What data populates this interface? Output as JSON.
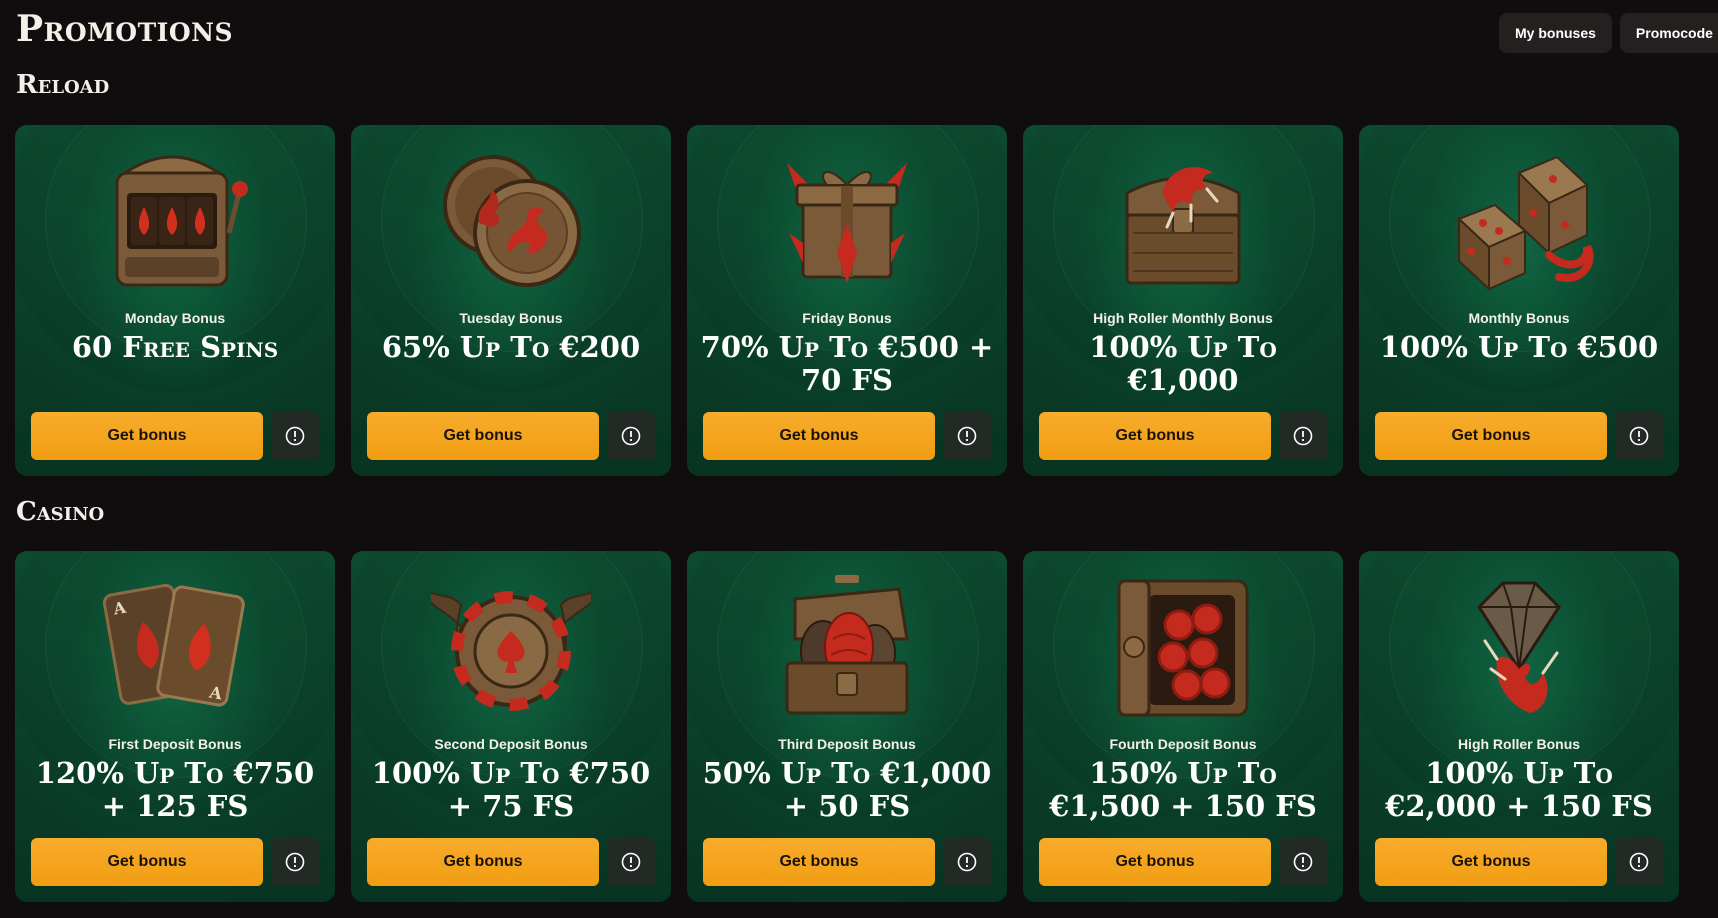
{
  "page_title": "Promotions",
  "top_actions": {
    "my_bonuses": "My bonuses",
    "promocode": "Promocode"
  },
  "sections": [
    {
      "title": "Reload",
      "cards": [
        {
          "subtitle": "Monday Bonus",
          "title": "60 Free Spins",
          "icon": "slot-machine-icon",
          "button": "Get bonus"
        },
        {
          "subtitle": "Tuesday Bonus",
          "title": "65% Up To €200",
          "icon": "dragon-coins-icon",
          "button": "Get bonus"
        },
        {
          "subtitle": "Friday Bonus",
          "title": "70% Up To €500 + 70 FS",
          "icon": "gift-box-icon",
          "button": "Get bonus"
        },
        {
          "subtitle": "High Roller Monthly Bonus",
          "title": "100% Up To €1,000",
          "icon": "treasure-chest-claw-icon",
          "button": "Get bonus"
        },
        {
          "subtitle": "Monthly Bonus",
          "title": "100% Up To €500",
          "icon": "dice-icon",
          "button": "Get bonus"
        }
      ]
    },
    {
      "title": "Casino",
      "cards": [
        {
          "subtitle": "First Deposit Bonus",
          "title": "120% Up To €750 + 125 FS",
          "icon": "playing-cards-icon",
          "button": "Get bonus"
        },
        {
          "subtitle": "Second Deposit Bonus",
          "title": "100% Up To €750 + 75 FS",
          "icon": "winged-chip-icon",
          "button": "Get bonus"
        },
        {
          "subtitle": "Third Deposit Bonus",
          "title": "50% Up To €1,000 + 50 FS",
          "icon": "egg-chest-icon",
          "button": "Get bonus"
        },
        {
          "subtitle": "Fourth Deposit Bonus",
          "title": "150% Up To €1,500 + 150 FS",
          "icon": "safe-icon",
          "button": "Get bonus"
        },
        {
          "subtitle": "High Roller Bonus",
          "title": "100% Up To €2,000 + 150 FS",
          "icon": "diamond-claw-icon",
          "button": "Get bonus"
        }
      ]
    }
  ],
  "colors": {
    "background": "#0f0d0d",
    "card_green": "#0b4029",
    "accent_orange": "#f5a623",
    "dragon_red": "#c42a1e",
    "bronze": "#8a6a45"
  }
}
